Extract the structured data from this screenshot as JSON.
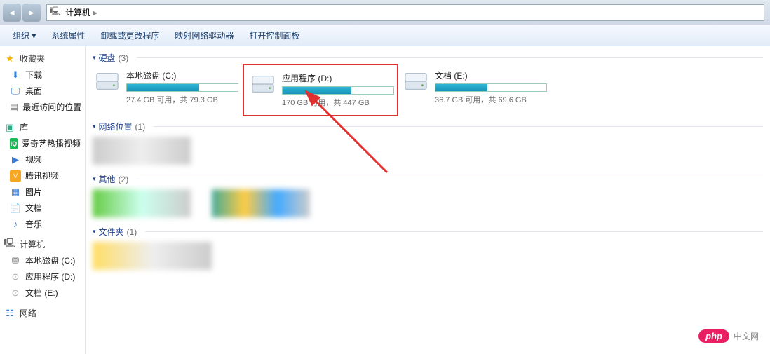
{
  "titlebar": {
    "location": "计算机"
  },
  "toolbar": {
    "organize": "组织 ▾",
    "properties": "系统属性",
    "uninstall": "卸载或更改程序",
    "map_drive": "映射网络驱动器",
    "control_panel": "打开控制面板"
  },
  "sidebar": {
    "favorites": "收藏夹",
    "downloads": "下载",
    "desktop": "桌面",
    "recent": "最近访问的位置",
    "libraries": "库",
    "iqiyi": "爱奇艺热播视频",
    "video": "视频",
    "tencent": "腾讯视频",
    "pictures": "图片",
    "documents": "文档",
    "music": "音乐",
    "computer": "计算机",
    "drive_c": "本地磁盘 (C:)",
    "drive_d": "应用程序 (D:)",
    "drive_e": "文档 (E:)",
    "network": "网络"
  },
  "sections": {
    "hdd": {
      "label": "硬盘",
      "count": "(3)"
    },
    "netloc": {
      "label": "网络位置",
      "count": "(1)"
    },
    "other": {
      "label": "其他",
      "count": "(2)"
    },
    "folders": {
      "label": "文件夹",
      "count": "(1)"
    }
  },
  "drives": [
    {
      "name": "本地磁盘 (C:)",
      "free": "27.4 GB 可用，共 79.3 GB",
      "used_pct": 65,
      "highlight": false
    },
    {
      "name": "应用程序 (D:)",
      "free": "170 GB 可用，共 447 GB",
      "used_pct": 62,
      "highlight": true
    },
    {
      "name": "文档 (E:)",
      "free": "36.7 GB 可用，共 69.6 GB",
      "used_pct": 47,
      "highlight": false
    }
  ],
  "watermark": {
    "badge": "php",
    "text": "中文网"
  }
}
